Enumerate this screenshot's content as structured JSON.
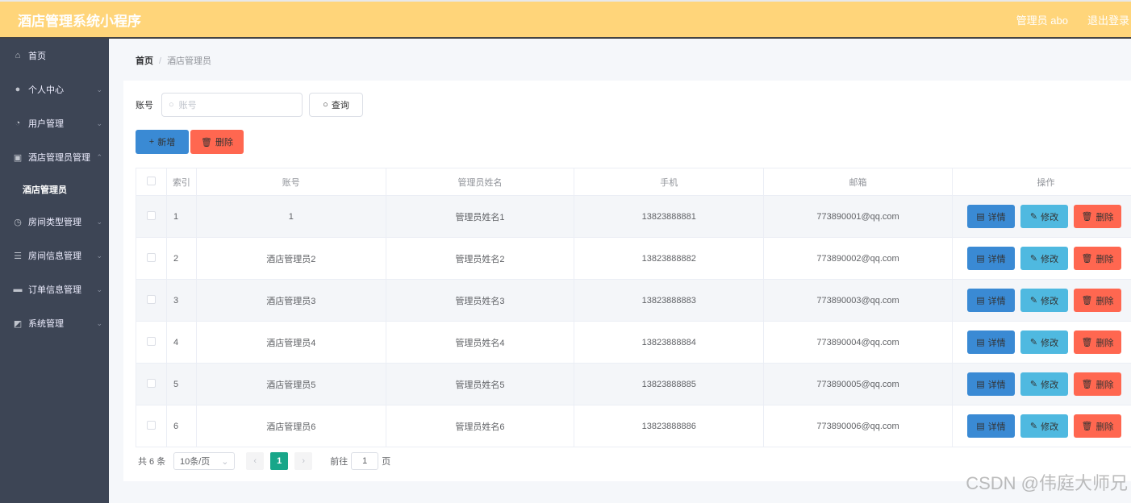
{
  "header": {
    "title": "酒店管理系统小程序",
    "user": "管理员 abo",
    "logout": "退出登录"
  },
  "colors": {
    "header": "#ffd57a",
    "sidebar": "#3d4555",
    "primary": "#3a8ad4",
    "info": "#4fb9e0",
    "danger": "#ff6750",
    "pager_active": "#18a689"
  },
  "sidebar": {
    "items": [
      {
        "label": "首页",
        "icon": "home-icon",
        "has_children": false
      },
      {
        "label": "个人中心",
        "icon": "user-icon",
        "has_children": true
      },
      {
        "label": "用户管理",
        "icon": "dashboard-icon",
        "has_children": true
      },
      {
        "label": "酒店管理员管理",
        "icon": "clipboard-icon",
        "has_children": true,
        "expanded": true,
        "children": [
          {
            "label": "酒店管理员"
          }
        ]
      },
      {
        "label": "房间类型管理",
        "icon": "clock-icon",
        "has_children": true
      },
      {
        "label": "房间信息管理",
        "icon": "list-icon",
        "has_children": true
      },
      {
        "label": "订单信息管理",
        "icon": "monitor-icon",
        "has_children": true
      },
      {
        "label": "系统管理",
        "icon": "chart-icon",
        "has_children": true
      }
    ]
  },
  "breadcrumb": {
    "home": "首页",
    "current": "酒店管理员"
  },
  "search": {
    "label": "账号",
    "placeholder": "账号",
    "button": "查询"
  },
  "actions": {
    "add": "新增",
    "delete": "删除"
  },
  "table": {
    "columns": [
      "",
      "索引",
      "账号",
      "管理员姓名",
      "手机",
      "邮箱",
      "操作"
    ],
    "row_actions": {
      "detail": "详情",
      "edit": "修改",
      "delete": "删除"
    },
    "rows": [
      {
        "index": "1",
        "account": "1",
        "name": "管理员姓名1",
        "phone": "13823888881",
        "email": "773890001@qq.com"
      },
      {
        "index": "2",
        "account": "酒店管理员2",
        "name": "管理员姓名2",
        "phone": "13823888882",
        "email": "773890002@qq.com"
      },
      {
        "index": "3",
        "account": "酒店管理员3",
        "name": "管理员姓名3",
        "phone": "13823888883",
        "email": "773890003@qq.com"
      },
      {
        "index": "4",
        "account": "酒店管理员4",
        "name": "管理员姓名4",
        "phone": "13823888884",
        "email": "773890004@qq.com"
      },
      {
        "index": "5",
        "account": "酒店管理员5",
        "name": "管理员姓名5",
        "phone": "13823888885",
        "email": "773890005@qq.com"
      },
      {
        "index": "6",
        "account": "酒店管理员6",
        "name": "管理员姓名6",
        "phone": "13823888886",
        "email": "773890006@qq.com"
      }
    ]
  },
  "pagination": {
    "total": "共 6 条",
    "page_size": "10条/页",
    "current": "1",
    "goto_label": "前往",
    "goto_value": "1",
    "page_unit": "页"
  },
  "watermark": "CSDN @伟庭大师兄"
}
